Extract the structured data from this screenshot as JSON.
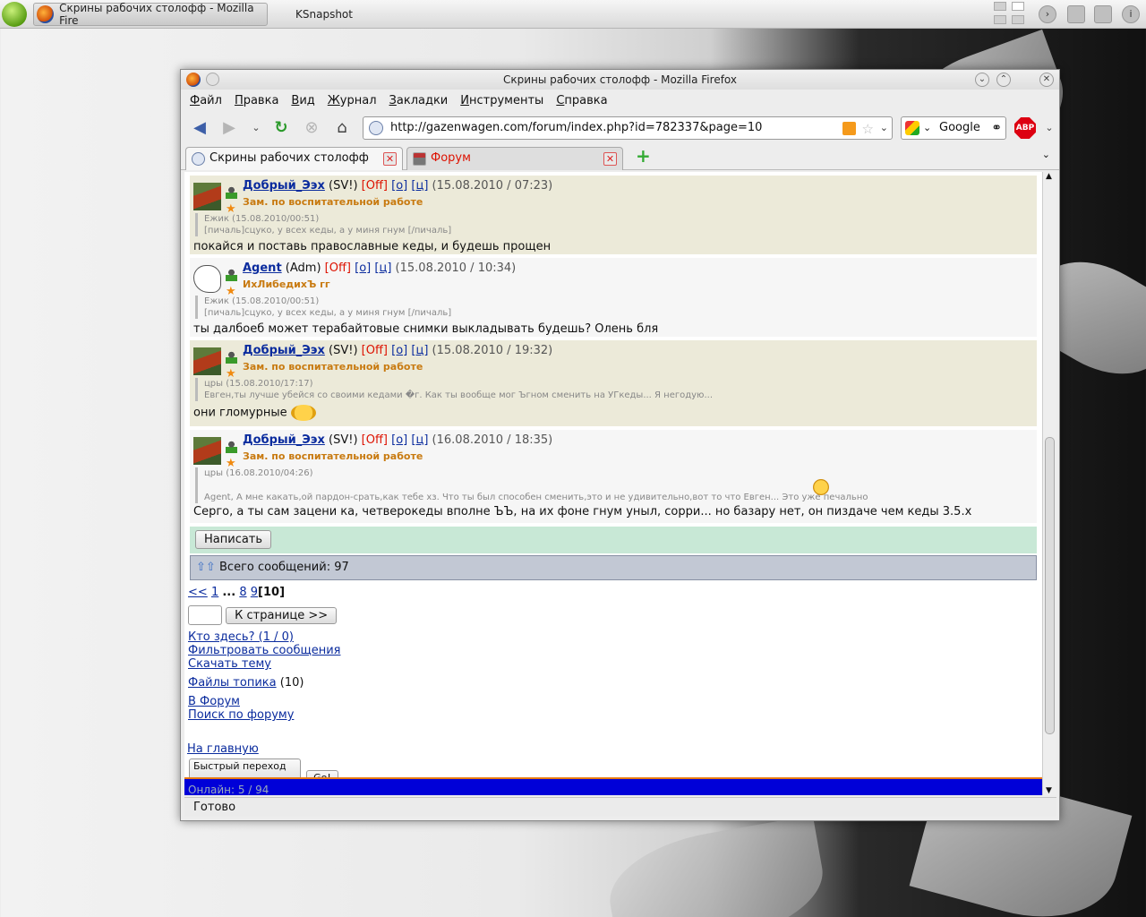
{
  "taskbar": {
    "tasks": [
      {
        "label": "Скрины рабочих столофф - Mozilla Fire"
      },
      {
        "label": "KSnapshot"
      }
    ]
  },
  "window": {
    "title": "Скрины рабочих столофф - Mozilla Firefox"
  },
  "menu": [
    "Файл",
    "Правка",
    "Вид",
    "Журнал",
    "Закладки",
    "Инструменты",
    "Справка"
  ],
  "toolbar": {
    "url": "http://gazenwagen.com/forum/index.php?id=782337&page=10",
    "search_engine": "Google",
    "abp_label": "ABP"
  },
  "tabs": [
    {
      "label": "Скрины рабочих столофф"
    },
    {
      "label": "Форум"
    }
  ],
  "posts": [
    {
      "nick": "Добрый_Ээх",
      "role": "(SV!)",
      "status": "[Off]",
      "link_o": "[o]",
      "link_c": "[ц]",
      "date": "(15.08.2010 / 07:23)",
      "rank": "Зам. по воспитательной работе",
      "quote_author": "Ежик (15.08.2010/00:51)",
      "quote_text": "[пичаль]сцуко, у всех кеды, а у миня гнум [/пичаль]",
      "message": "покайся и поставь православные кеды, и будешь прощен"
    },
    {
      "nick": "Agent",
      "role": "(Adm)",
      "status": "[Off]",
      "link_o": "[o]",
      "link_c": "[ц]",
      "date": "(15.08.2010 / 10:34)",
      "rank": "ИхЛибедихЪ гг",
      "quote_author": "Ежик (15.08.2010/00:51)",
      "quote_text": "[пичаль]сцуко, у всех кеды, а у миня гнум [/пичаль]",
      "message": "ты далбоеб может терабайтовые снимки выкладывать будешь? Олень бля"
    },
    {
      "nick": "Добрый_Ээх",
      "role": "(SV!)",
      "status": "[Off]",
      "link_o": "[o]",
      "link_c": "[ц]",
      "date": "(15.08.2010 / 19:32)",
      "rank": "Зам. по воспитательной работе",
      "quote_author": "цры (15.08.2010/17:17)",
      "quote_text": "Евген,ты лучше убейся со своими кедами �г. Как ты вообще мог Ъгном сменить на УГкеды... Я негодую...",
      "message": "они гломурные"
    },
    {
      "nick": "Добрый_Ээх",
      "role": "(SV!)",
      "status": "[Off]",
      "link_o": "[o]",
      "link_c": "[ц]",
      "date": "(16.08.2010 / 18:35)",
      "rank": "Зам. по воспитательной работе",
      "quote_author": "цры (16.08.2010/04:26)",
      "quote_text": "Agent, А мне какать,ой пардон-срать,как тебе хз. Что ты был способен сменить,это и не удивительно,вот то что Евген... Это уже печально",
      "message": "Серго, а ты сам зацени ка, четверокеды вполне ЪЪ, на их фоне гнум уныл, сорри... но базару нет, он пиздаче чем кеды 3.5.х"
    }
  ],
  "reply_button": "Написать",
  "total_label": "Всего сообщений: 97",
  "pagination": {
    "prev": "<<",
    "first": "1",
    "dots": "...",
    "p8": "8",
    "p9": "9",
    "current": "[10]"
  },
  "goto_button": "К странице >>",
  "links": {
    "who_here": "Кто здесь? (1 / 0)",
    "filter": "Фильтровать сообщения",
    "download": "Скачать тему",
    "files": "Файлы топика",
    "files_count": "(10)",
    "to_forum": "В Форум",
    "search_forum": "Поиск по форуму",
    "home": "На главную"
  },
  "quick_jump": {
    "selected": "Быстрый переход",
    "go": "Go!"
  },
  "footer_text": "Онлайн: 5 / 94",
  "statusbar": "Готово"
}
